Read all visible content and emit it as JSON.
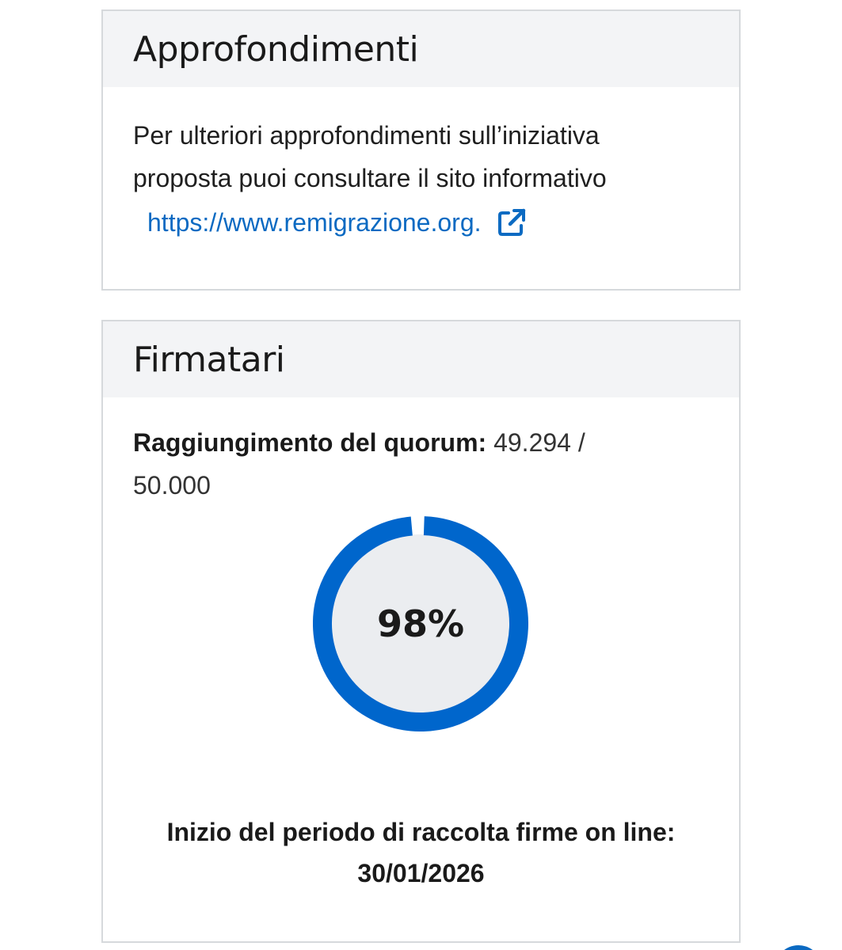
{
  "approfondimenti": {
    "title": "Approfondimenti",
    "text_line1": "Per ulteriori approfondimenti sull’iniziativa",
    "text_line2": "proposta puoi consultare il sito informativo",
    "link_text": "https://www.remigrazione.org.",
    "link_icon": "external-link-icon",
    "link_color": "#0b6ac2"
  },
  "firmatari": {
    "title": "Firmatari",
    "quorum_label": "Raggiungimento del quorum:",
    "quorum_value": "49.294 /",
    "quorum_total": "50.000",
    "progress_fraction": 0.98,
    "progress_label": "98%",
    "progress_color": "#0066cc",
    "progress_track_color": "#ebedf0",
    "period_label": "Inizio del periodo di raccolta firme on line:",
    "period_date": "30/01/2026"
  },
  "colors": {
    "header_bg": "#f3f4f6",
    "border": "#d6d9dc",
    "accent": "#0b6ac2"
  }
}
